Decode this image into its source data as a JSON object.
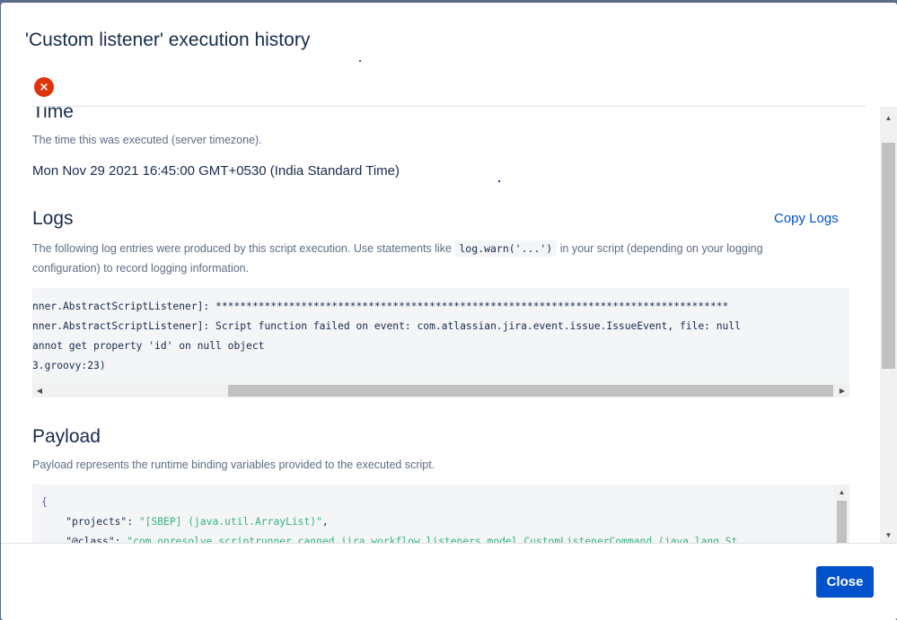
{
  "dialog": {
    "title": "'Custom listener' execution history",
    "error_icon": "×"
  },
  "time": {
    "heading": "Time",
    "description": "The time this was executed (server timezone).",
    "value": "Mon Nov 29 2021 16:45:00 GMT+0530 (India Standard Time)"
  },
  "logs": {
    "heading": "Logs",
    "copy_label": "Copy Logs",
    "description_before": "The following log entries were produced by this script execution. Use statements like ",
    "inline_code": "log.warn('...')",
    "description_after": " in your script (depending on your logging configuration) to record logging information.",
    "lines": [
      "nner.AbstractScriptListener]: ************************************************************************************",
      "nner.AbstractScriptListener]: Script function failed on event: com.atlassian.jira.event.issue.IssueEvent, file: null",
      "annot get property 'id' on null object",
      "3.groovy:23)"
    ]
  },
  "payload": {
    "heading": "Payload",
    "description": "Payload represents the runtime binding variables provided to the executed script.",
    "open_brace": "{",
    "entries": [
      {
        "key": "\"projects\"",
        "value": "\"[SBEP] (java.util.ArrayList)\"",
        "trail": ","
      },
      {
        "key": "\"@class\"",
        "value": "\"com.onresolve.scriptrunner.canned.jira.workflow.listeners.model.CustomListenerCommand (java.lang.St",
        "trail": ""
      }
    ]
  },
  "footer": {
    "close_label": "Close"
  },
  "colors": {
    "primary": "#0052cc",
    "error": "#de350b",
    "string": "#36b37e"
  }
}
